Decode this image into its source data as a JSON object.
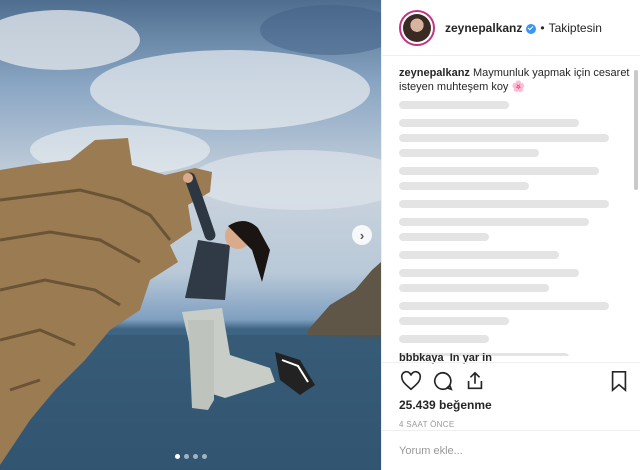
{
  "post": {
    "username": "zeynepalkanz",
    "separator": "•",
    "follow_status": "Takiptesin",
    "caption_user": "zeynepalkanz",
    "caption_text": "Maymunluk yapmak için cesaret isteyen muhteşem koy",
    "caption_emoji": "🌸",
    "visible_comment": "bbbkaya_In yar in",
    "likes": "25.439 beğenme",
    "time": "4 SAAT ÖNCE",
    "comment_placeholder": "Yorum ekle..."
  },
  "carousel": {
    "total": 4,
    "active": 1
  },
  "icons": {
    "like": "heart-icon",
    "comment": "comment-icon",
    "share": "share-icon",
    "save": "bookmark-icon",
    "next": "chevron-right-icon",
    "verified": "verified-badge-icon"
  },
  "colors": {
    "verified": "#3897f0",
    "avatar_ring": "#c13584"
  }
}
